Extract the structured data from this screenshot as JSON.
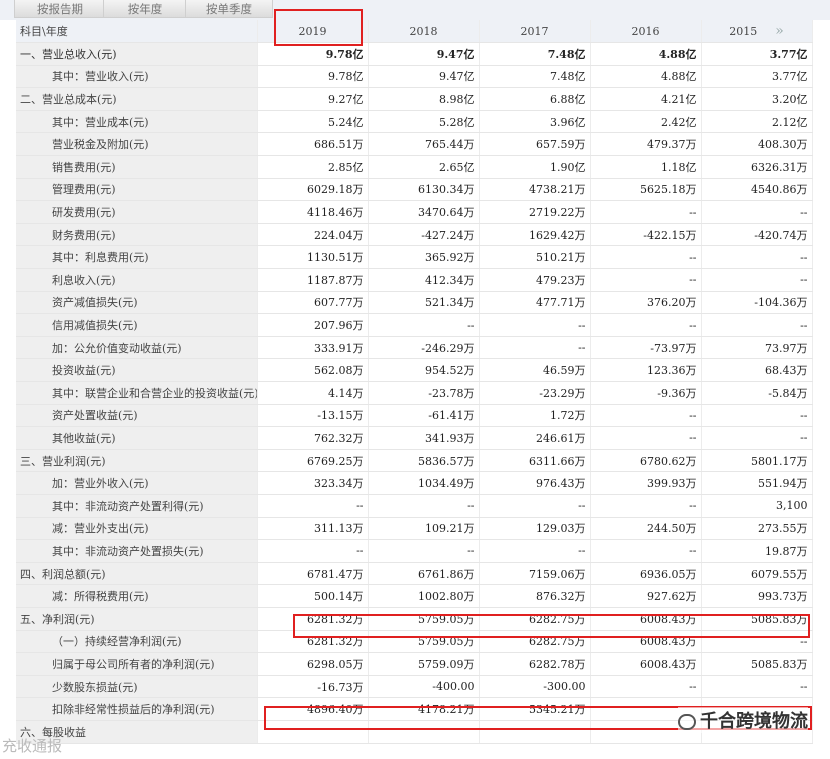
{
  "tabs": [
    "按报告期",
    "按年度",
    "按单季度"
  ],
  "header": {
    "row_label": "科目\\年度",
    "years": [
      "2019",
      "2018",
      "2017",
      "2016",
      "2015"
    ]
  },
  "rows": [
    {
      "label": "一、营业总收入(元)",
      "level": 0,
      "bold": true,
      "values": [
        "9.78亿",
        "9.47亿",
        "7.48亿",
        "4.88亿",
        "3.77亿"
      ]
    },
    {
      "label": "其中：营业收入(元)",
      "level": 1,
      "values": [
        "9.78亿",
        "9.47亿",
        "7.48亿",
        "4.88亿",
        "3.77亿"
      ]
    },
    {
      "label": "二、营业总成本(元)",
      "level": 0,
      "values": [
        "9.27亿",
        "8.98亿",
        "6.88亿",
        "4.21亿",
        "3.20亿"
      ]
    },
    {
      "label": "其中：营业成本(元)",
      "level": 1,
      "values": [
        "5.24亿",
        "5.28亿",
        "3.96亿",
        "2.42亿",
        "2.12亿"
      ]
    },
    {
      "label": "营业税金及附加(元)",
      "level": 1,
      "values": [
        "686.51万",
        "765.44万",
        "657.59万",
        "479.37万",
        "408.30万"
      ]
    },
    {
      "label": "销售费用(元)",
      "level": 1,
      "values": [
        "2.85亿",
        "2.65亿",
        "1.90亿",
        "1.18亿",
        "6326.31万"
      ]
    },
    {
      "label": "管理费用(元)",
      "level": 1,
      "values": [
        "6029.18万",
        "6130.34万",
        "4738.21万",
        "5625.18万",
        "4540.86万"
      ]
    },
    {
      "label": "研发费用(元)",
      "level": 1,
      "values": [
        "4118.46万",
        "3470.64万",
        "2719.22万",
        "--",
        "--"
      ]
    },
    {
      "label": "财务费用(元)",
      "level": 1,
      "values": [
        "224.04万",
        "-427.24万",
        "1629.42万",
        "-422.15万",
        "-420.74万"
      ]
    },
    {
      "label": "其中：利息费用(元)",
      "level": 1,
      "values": [
        "1130.51万",
        "365.92万",
        "510.21万",
        "--",
        "--"
      ]
    },
    {
      "label": "利息收入(元)",
      "level": 1,
      "values": [
        "1187.87万",
        "412.34万",
        "479.23万",
        "--",
        "--"
      ]
    },
    {
      "label": "资产减值损失(元)",
      "level": 1,
      "values": [
        "607.77万",
        "521.34万",
        "477.71万",
        "376.20万",
        "-104.36万"
      ]
    },
    {
      "label": "信用减值损失(元)",
      "level": 1,
      "values": [
        "207.96万",
        "--",
        "--",
        "--",
        "--"
      ]
    },
    {
      "label": "加：公允价值变动收益(元)",
      "level": 1,
      "values": [
        "333.91万",
        "-246.29万",
        "--",
        "-73.97万",
        "73.97万"
      ]
    },
    {
      "label": "投资收益(元)",
      "level": 1,
      "values": [
        "562.08万",
        "954.52万",
        "46.59万",
        "123.36万",
        "68.43万"
      ]
    },
    {
      "label": "其中：联营企业和合营企业的投资收益(元)",
      "level": 1,
      "values": [
        "4.14万",
        "-23.78万",
        "-23.29万",
        "-9.36万",
        "-5.84万"
      ]
    },
    {
      "label": "资产处置收益(元)",
      "level": 1,
      "values": [
        "-13.15万",
        "-61.41万",
        "1.72万",
        "--",
        "--"
      ]
    },
    {
      "label": "其他收益(元)",
      "level": 1,
      "values": [
        "762.32万",
        "341.93万",
        "246.61万",
        "--",
        "--"
      ]
    },
    {
      "label": "三、营业利润(元)",
      "level": 0,
      "values": [
        "6769.25万",
        "5836.57万",
        "6311.66万",
        "6780.62万",
        "5801.17万"
      ]
    },
    {
      "label": "加：营业外收入(元)",
      "level": 1,
      "values": [
        "323.34万",
        "1034.49万",
        "976.43万",
        "399.93万",
        "551.94万"
      ]
    },
    {
      "label": "其中：非流动资产处置利得(元)",
      "level": 1,
      "values": [
        "--",
        "--",
        "--",
        "--",
        "3,100"
      ]
    },
    {
      "label": "减：营业外支出(元)",
      "level": 1,
      "values": [
        "311.13万",
        "109.21万",
        "129.03万",
        "244.50万",
        "273.55万"
      ]
    },
    {
      "label": "其中：非流动资产处置损失(元)",
      "level": 1,
      "values": [
        "--",
        "--",
        "--",
        "--",
        "19.87万"
      ]
    },
    {
      "label": "四、利润总额(元)",
      "level": 0,
      "values": [
        "6781.47万",
        "6761.86万",
        "7159.06万",
        "6936.05万",
        "6079.55万"
      ]
    },
    {
      "label": "减：所得税费用(元)",
      "level": 1,
      "values": [
        "500.14万",
        "1002.80万",
        "876.32万",
        "927.62万",
        "993.73万"
      ]
    },
    {
      "label": "五、净利润(元)",
      "level": 0,
      "values": [
        "6281.32万",
        "5759.05万",
        "6282.75万",
        "6008.43万",
        "5085.83万"
      ]
    },
    {
      "label": "（一）持续经营净利润(元)",
      "level": 1,
      "values": [
        "6281.32万",
        "5759.05万",
        "6282.75万",
        "6008.43万",
        "--"
      ]
    },
    {
      "label": "归属于母公司所有者的净利润(元)",
      "level": 1,
      "values": [
        "6298.05万",
        "5759.09万",
        "6282.78万",
        "6008.43万",
        "5085.83万"
      ]
    },
    {
      "label": "少数股东损益(元)",
      "level": 1,
      "values": [
        "-16.73万",
        "-400.00",
        "-300.00",
        "--",
        "--"
      ]
    },
    {
      "label": "扣除非经常性损益后的净利润(元)",
      "level": 1,
      "values": [
        "4896.40万",
        "4178.21万",
        "5345.21万",
        "",
        ""
      ]
    },
    {
      "label": "六、每股收益",
      "level": 0,
      "values": [
        "",
        "",
        "",
        "",
        ""
      ]
    }
  ],
  "watermark": {
    "text": "千合跨境物流",
    "icon": "wechat-icon",
    "corner_text": "充收通报"
  },
  "colors": {
    "highlight": "#e02020",
    "label_bg": "#efefef",
    "header_bg": "#eef1f6"
  }
}
